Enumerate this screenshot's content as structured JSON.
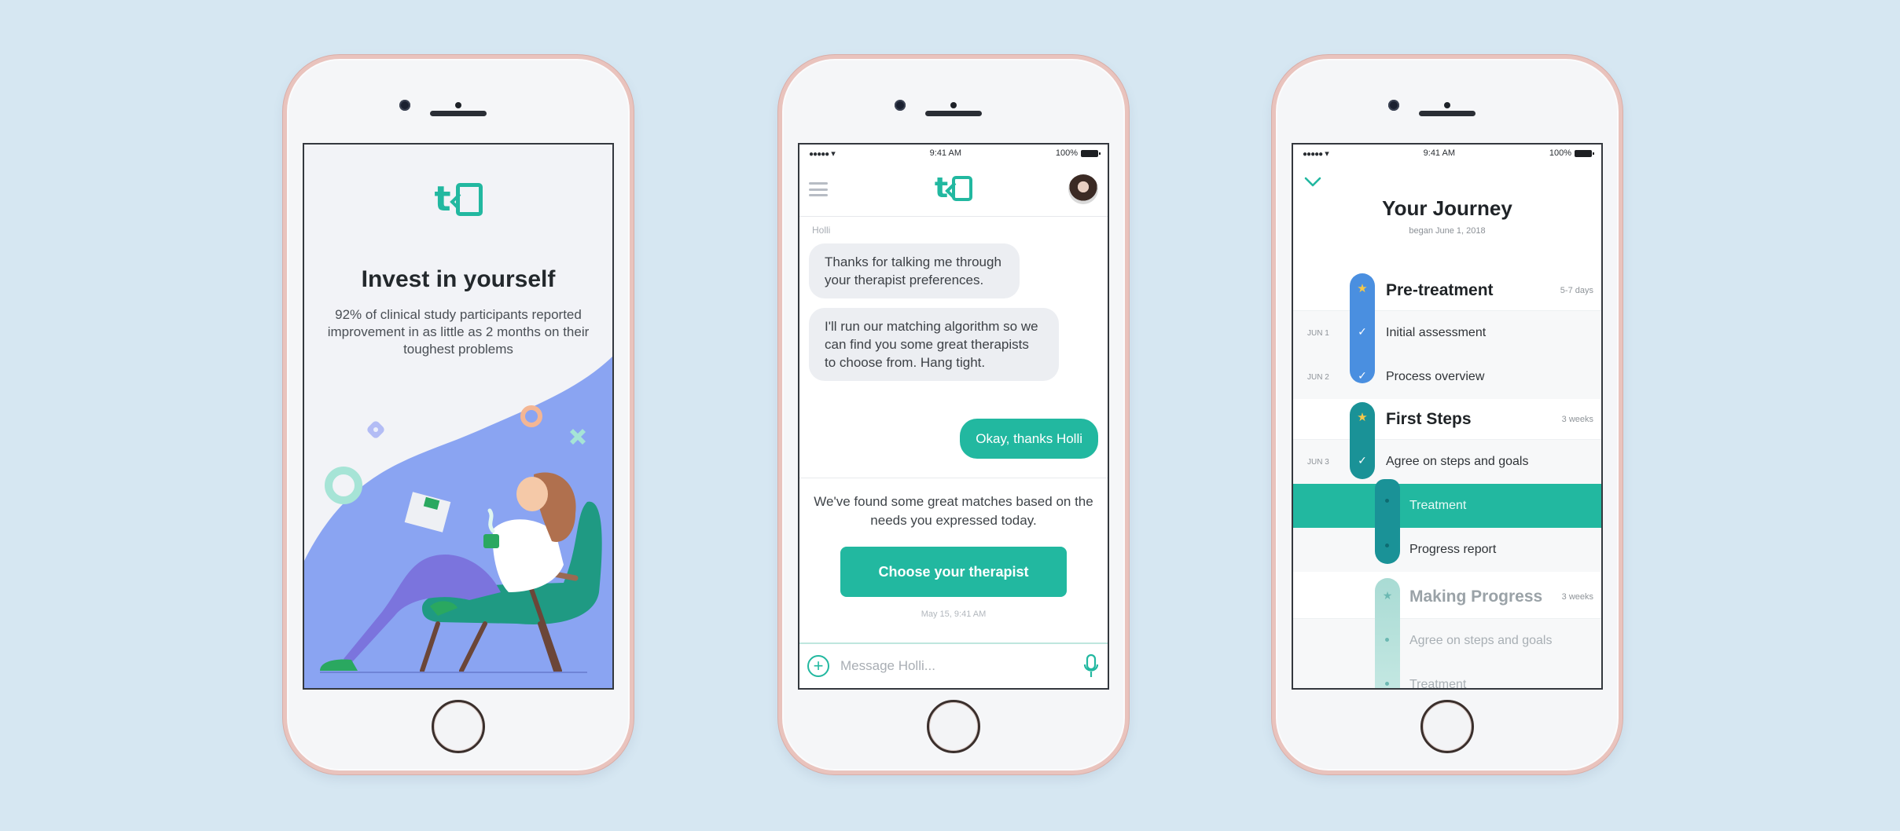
{
  "colors": {
    "background": "#d6e7f2",
    "brand": "#22b8a0",
    "phase_pretreatment": "#4a8fe0",
    "phase_first_steps": "#1a9297",
    "phase_making_progress": "#a9dbd4",
    "illustration_blue": "#8aa4f2"
  },
  "onboarding": {
    "logo": "t",
    "title": "Invest in yourself",
    "subtitle": "92% of clinical study participants reported improvement in as little as 2 months on their toughest problems"
  },
  "status_bar": {
    "signal": "●●●●●",
    "time": "9:41 AM",
    "battery": "100%"
  },
  "chat": {
    "logo": "t",
    "sender_name": "Holli",
    "messages": [
      {
        "from": "Holli",
        "text": "Thanks for talking me through your therapist preferences."
      },
      {
        "from": "Holli",
        "text": "I'll run our matching algorithm so we can find you some great therapists to choose from.  Hang tight."
      },
      {
        "from": "me",
        "text": "Okay, thanks Holli"
      }
    ],
    "match_text": "We've found some great matches based on the needs you expressed today.",
    "cta_label": "Choose your therapist",
    "timestamp": "May 15, 9:41 AM",
    "composer_placeholder": "Message Holli...",
    "plus_symbol": "+"
  },
  "journey": {
    "title": "Your Journey",
    "subtitle": "began June 1, 2018",
    "phases": [
      {
        "name": "Pre-treatment",
        "duration": "5-7 days",
        "status": "complete",
        "steps": [
          {
            "date": "JUN 1",
            "label": "Initial assessment",
            "status": "done"
          },
          {
            "date": "JUN 2",
            "label": "Process overview",
            "status": "done"
          }
        ]
      },
      {
        "name": "First Steps",
        "duration": "3 weeks",
        "status": "in-progress",
        "steps": [
          {
            "date": "JUN 3",
            "label": "Agree on steps and goals",
            "status": "done"
          },
          {
            "date": "",
            "label": "Treatment",
            "status": "current"
          },
          {
            "date": "",
            "label": "Progress report",
            "status": "upcoming"
          }
        ]
      },
      {
        "name": "Making Progress",
        "duration": "3 weeks",
        "status": "locked",
        "steps": [
          {
            "date": "",
            "label": "Agree on steps and goals",
            "status": "upcoming"
          },
          {
            "date": "",
            "label": "Treatment",
            "status": "upcoming"
          }
        ]
      }
    ]
  }
}
